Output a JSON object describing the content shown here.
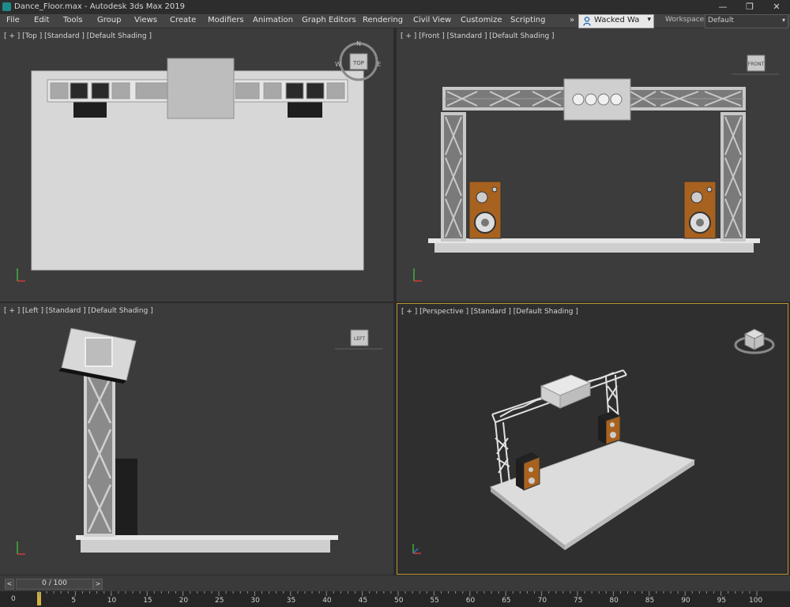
{
  "window": {
    "title": "Dance_Floor.max - Autodesk 3ds Max 2019",
    "controls": [
      "—",
      "❐",
      "✕"
    ]
  },
  "menu": [
    {
      "key": "file",
      "label": "File"
    },
    {
      "key": "edit",
      "label": "Edit"
    },
    {
      "key": "tools",
      "label": "Tools"
    },
    {
      "key": "group",
      "label": "Group"
    },
    {
      "key": "views",
      "label": "Views"
    },
    {
      "key": "create",
      "label": "Create"
    },
    {
      "key": "modifiers",
      "label": "Modifiers"
    },
    {
      "key": "animation",
      "label": "Animation"
    },
    {
      "key": "graph",
      "label": "Graph Editors"
    },
    {
      "key": "rendering",
      "label": "Rendering"
    },
    {
      "key": "civil",
      "label": "Civil View"
    },
    {
      "key": "customize",
      "label": "Customize"
    },
    {
      "key": "scripting",
      "label": "Scripting"
    }
  ],
  "menu_overflow": "»",
  "user": {
    "name": "Wacked Wa",
    "arrow": "▾"
  },
  "workspaces": {
    "label": "Workspaces:",
    "value": "Default",
    "arrow": "▾"
  },
  "viewports": {
    "top": {
      "label": "[ + ] [Top ] [Standard ] [Default Shading ]",
      "cube_label": "TOP",
      "compass": {
        "n": "N",
        "w": "W",
        "e": "E"
      }
    },
    "front": {
      "label": "[ + ] [Front ] [Standard ] [Default Shading ]",
      "cube_label": "FRONT"
    },
    "left": {
      "label": "[ + ] [Left ] [Standard ] [Default Shading ]",
      "cube_label": "LEFT"
    },
    "perspective": {
      "label": "[ + ] [Perspective ] [Standard ] [Default Shading ]"
    }
  },
  "time_slider": {
    "value": "0 / 100",
    "prev": "<",
    "next": ">"
  },
  "track": {
    "nav_label": "0",
    "ticks": [
      5,
      10,
      15,
      20,
      25,
      30,
      35,
      40,
      45,
      50,
      55,
      60,
      65,
      70,
      75,
      80,
      85,
      90,
      95,
      100
    ]
  },
  "colors": {
    "accent": "#b9952d",
    "speaker": "#a8621f",
    "truss": "#d8d8d8",
    "floor": "#e0e0e0"
  }
}
